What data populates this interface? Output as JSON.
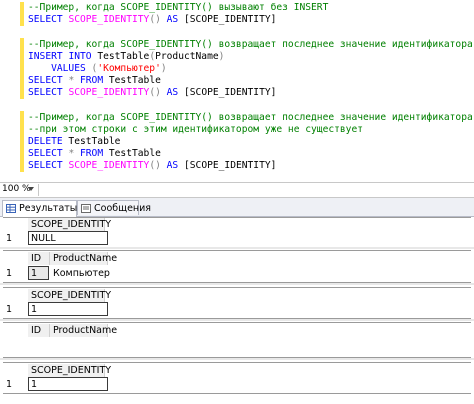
{
  "editor": {
    "lines": [
      [
        {
          "t": "--Пример, когда SCOPE_IDENTITY() вызывают без INSERT",
          "c": "c"
        }
      ],
      [
        {
          "t": "SELECT",
          "c": "k"
        },
        {
          "t": " ",
          "c": ""
        },
        {
          "t": "SCOPE_IDENTITY",
          "c": "f"
        },
        {
          "t": "()",
          "c": "g"
        },
        {
          "t": " ",
          "c": ""
        },
        {
          "t": "AS",
          "c": "k"
        },
        {
          "t": " [SCOPE_IDENTITY]",
          "c": ""
        }
      ],
      [],
      [
        {
          "t": "--Пример, когда SCOPE_IDENTITY() возвращает последнее значение идентификатора",
          "c": "c"
        }
      ],
      [
        {
          "t": "INSERT",
          "c": "k"
        },
        {
          "t": " ",
          "c": ""
        },
        {
          "t": "INTO",
          "c": "k"
        },
        {
          "t": " TestTable",
          "c": ""
        },
        {
          "t": "(",
          "c": "g"
        },
        {
          "t": "ProductName",
          "c": ""
        },
        {
          "t": ")",
          "c": "g"
        }
      ],
      [
        {
          "t": "    ",
          "c": ""
        },
        {
          "t": "VALUES",
          "c": "k"
        },
        {
          "t": " ",
          "c": ""
        },
        {
          "t": "(",
          "c": "g"
        },
        {
          "t": "'Компьютер'",
          "c": "s"
        },
        {
          "t": ")",
          "c": "g"
        }
      ],
      [
        {
          "t": "SELECT",
          "c": "k"
        },
        {
          "t": " ",
          "c": ""
        },
        {
          "t": "*",
          "c": "g"
        },
        {
          "t": " ",
          "c": ""
        },
        {
          "t": "FROM",
          "c": "k"
        },
        {
          "t": " TestTable",
          "c": ""
        }
      ],
      [
        {
          "t": "SELECT",
          "c": "k"
        },
        {
          "t": " ",
          "c": ""
        },
        {
          "t": "SCOPE_IDENTITY",
          "c": "f"
        },
        {
          "t": "()",
          "c": "g"
        },
        {
          "t": " ",
          "c": ""
        },
        {
          "t": "AS",
          "c": "k"
        },
        {
          "t": " [SCOPE_IDENTITY]",
          "c": ""
        }
      ],
      [],
      [
        {
          "t": "--Пример, когда SCOPE_IDENTITY() возвращает последнее значение идентификатора,",
          "c": "c"
        }
      ],
      [
        {
          "t": "--при этом строки с этим идентификатором уже не существует",
          "c": "c"
        }
      ],
      [
        {
          "t": "DELETE",
          "c": "k"
        },
        {
          "t": " TestTable",
          "c": ""
        }
      ],
      [
        {
          "t": "SELECT",
          "c": "k"
        },
        {
          "t": " ",
          "c": ""
        },
        {
          "t": "*",
          "c": "g"
        },
        {
          "t": " ",
          "c": ""
        },
        {
          "t": "FROM",
          "c": "k"
        },
        {
          "t": " TestTable",
          "c": ""
        }
      ],
      [
        {
          "t": "SELECT",
          "c": "k"
        },
        {
          "t": " ",
          "c": ""
        },
        {
          "t": "SCOPE_IDENTITY",
          "c": "f"
        },
        {
          "t": "()",
          "c": "g"
        },
        {
          "t": " ",
          "c": ""
        },
        {
          "t": "AS",
          "c": "k"
        },
        {
          "t": " [SCOPE_IDENTITY]",
          "c": ""
        }
      ]
    ]
  },
  "zoom": {
    "value": "100 %"
  },
  "tabs": [
    {
      "label": "Результаты",
      "icon": "results-grid-icon",
      "active": true
    },
    {
      "label": "Сообщения",
      "icon": "messages-icon",
      "active": false
    }
  ],
  "results": {
    "grid1": {
      "header": "SCOPE_IDENTITY",
      "rownum": "1",
      "value": "NULL"
    },
    "grid2": {
      "header_id": "ID",
      "header_name": "ProductName",
      "rownum": "1",
      "id": "1",
      "name": "Компьютер"
    },
    "grid3": {
      "header": "SCOPE_IDENTITY",
      "rownum": "1",
      "value": "1"
    },
    "grid4": {
      "header_id": "ID",
      "header_name": "ProductName"
    },
    "grid5": {
      "header": "SCOPE_IDENTITY",
      "rownum": "1",
      "value": "1"
    }
  },
  "colors": {
    "comment": "#008000",
    "keyword": "#0000ff",
    "function": "#ff00ff",
    "operator": "#808080",
    "string": "#ff0000",
    "change_bar": "#ffe14d"
  }
}
